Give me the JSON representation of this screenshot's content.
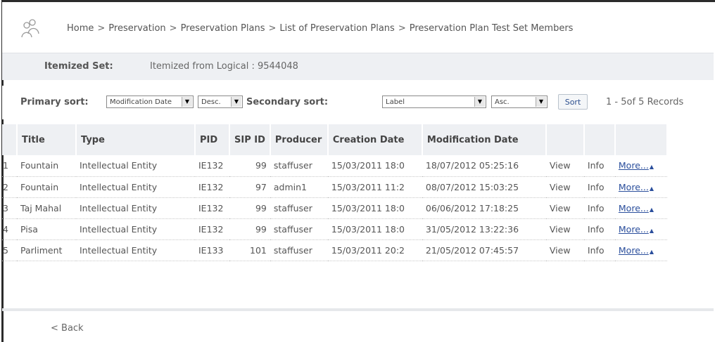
{
  "breadcrumb": {
    "items": [
      "Home",
      "Preservation",
      "Preservation Plans",
      "List of Preservation Plans",
      "Preservation Plan Test Set Members"
    ],
    "separator": ">"
  },
  "itemized": {
    "label": "Itemized Set:",
    "value": "Itemized from Logical : 9544048"
  },
  "sort": {
    "primary_label": "Primary sort:",
    "primary_field": "Modification Date",
    "primary_order": "Desc.",
    "secondary_label": "Secondary sort:",
    "secondary_field": "Label",
    "secondary_order": "Asc.",
    "button": "Sort",
    "records": "1 - 5of 5 Records"
  },
  "table": {
    "headers": [
      "Title",
      "Type",
      "PID",
      "SIP ID",
      "Producer",
      "Creation Date",
      "Modification Date",
      "",
      "",
      ""
    ],
    "rows": [
      {
        "idx": "1",
        "title": "Fountain",
        "type": "Intellectual Entity",
        "pid": "IE132",
        "sip": "99",
        "producer": "staffuser",
        "created": "15/03/2011 18:0",
        "modified": "18/07/2012 05:25:16",
        "view": "View",
        "info": "Info",
        "more": "More..."
      },
      {
        "idx": "2",
        "title": "Fountain",
        "type": "Intellectual Entity",
        "pid": "IE132",
        "sip": "97",
        "producer": "admin1",
        "created": "15/03/2011 11:2",
        "modified": "08/07/2012 15:03:25",
        "view": "View",
        "info": "Info",
        "more": "More..."
      },
      {
        "idx": "3",
        "title": "Taj Mahal",
        "type": "Intellectual Entity",
        "pid": "IE132",
        "sip": "99",
        "producer": "staffuser",
        "created": "15/03/2011 18:0",
        "modified": "06/06/2012 17:18:25",
        "view": "View",
        "info": "Info",
        "more": "More..."
      },
      {
        "idx": "4",
        "title": "Pisa",
        "type": "Intellectual Entity",
        "pid": "IE132",
        "sip": "99",
        "producer": "staffuser",
        "created": "15/03/2011 18:0",
        "modified": "31/05/2012 13:22:36",
        "view": "View",
        "info": "Info",
        "more": "More..."
      },
      {
        "idx": "5",
        "title": "Parliment",
        "type": "Intellectual Entity",
        "pid": "IE133",
        "sip": "101",
        "producer": "staffuser",
        "created": "15/03/2011 20:2",
        "modified": "21/05/2012 07:45:57",
        "view": "View",
        "info": "Info",
        "more": "More..."
      }
    ]
  },
  "back": "< Back",
  "icons": {
    "logo": "people-icon",
    "dropdown": "chevron-down-icon",
    "more": "triangle-up-icon"
  },
  "colors": {
    "link": "#2a4e9c",
    "band": "#eef0f3"
  }
}
